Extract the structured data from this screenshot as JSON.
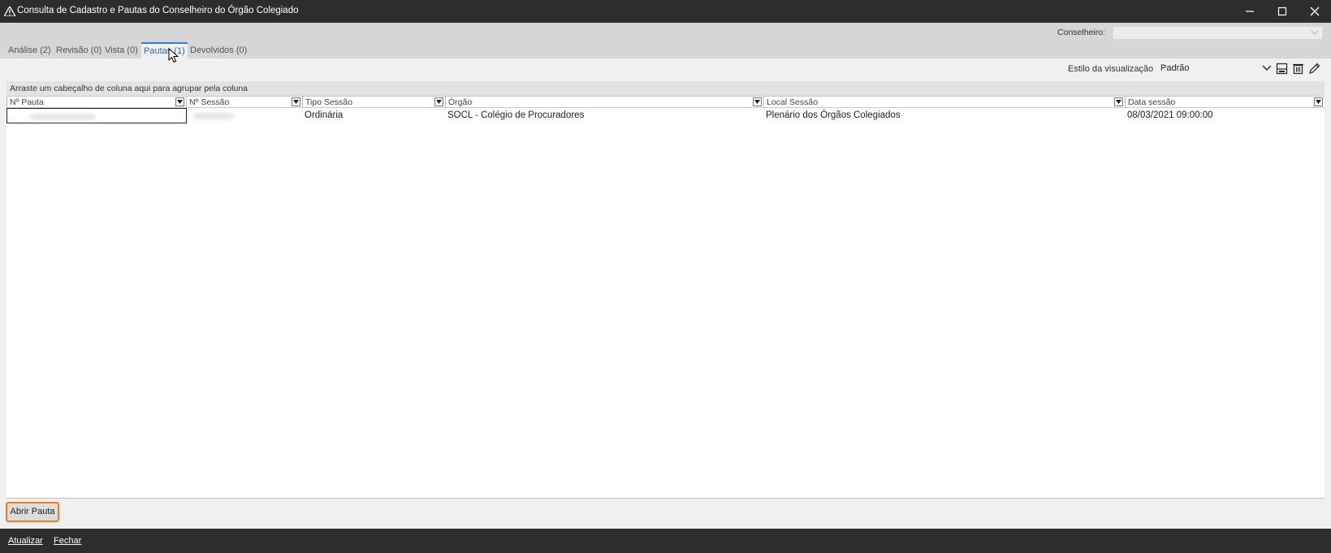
{
  "window": {
    "title": "Consulta de Cadastro e Pautas do Conselheiro do Órgão Colegiado",
    "icon": "warning-triangle-icon"
  },
  "filters": {
    "conselheiro_label": "Conselheiro:",
    "conselheiro_value": ""
  },
  "tabs": [
    {
      "label": "Análise (2)",
      "active": false
    },
    {
      "label": "Revisão (0)",
      "active": false
    },
    {
      "label": "Vista (0)",
      "active": false
    },
    {
      "label": "Pautas (1)",
      "active": true
    },
    {
      "label": "Devolvidos (0)",
      "active": false
    }
  ],
  "view": {
    "label": "Estilo da visualização",
    "selected": "Padrão",
    "icons": [
      "save-layout-icon",
      "delete-layout-icon",
      "edit-layout-icon"
    ]
  },
  "grid": {
    "group_hint": "Arraste um cabeçalho de coluna aqui para agrupar pela coluna",
    "columns": [
      "Nº Pauta",
      "Nº Sessão",
      "Tipo Sessão",
      "Órgão",
      "Local Sessão",
      "Data sessão"
    ],
    "rows": [
      {
        "pauta": "",
        "sessao": "",
        "tipo_sessao": "Ordinária",
        "orgao": "SOCL - Colégio de Procuradores",
        "local_sessao": "Plenário dos Órgãos Colegiados",
        "data_sessao": "08/03/2021 09:00:00"
      }
    ]
  },
  "actions": {
    "abrir_pauta": "Abrir Pauta"
  },
  "footer": {
    "atualizar": "Atualizar",
    "fechar": "Fechar"
  },
  "colors": {
    "titlebar": "#2d2d2d",
    "accent": "#2b7fd1",
    "highlight": "#ef7d22"
  }
}
